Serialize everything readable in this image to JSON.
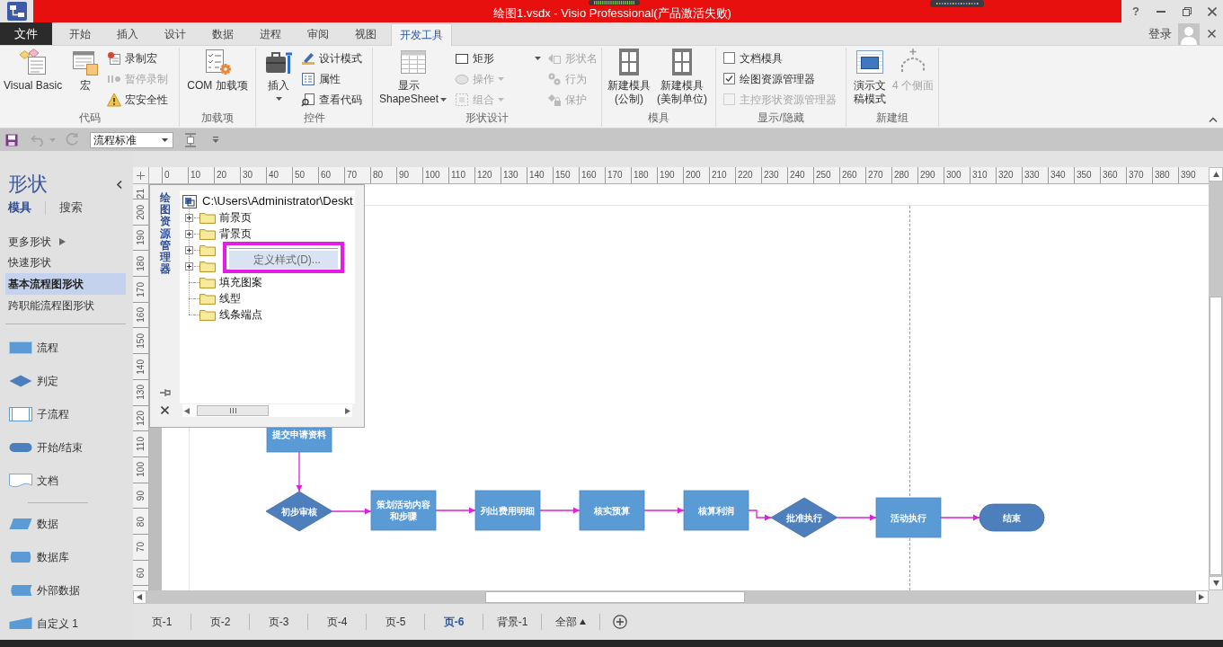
{
  "title_bar": {
    "title": "绘图1.vsdx - Visio Professional(产品激活失败)",
    "help": "?"
  },
  "menu_bar": {
    "file_tab": "文件",
    "tabs": [
      {
        "label": "开始",
        "selected": false
      },
      {
        "label": "插入",
        "selected": false
      },
      {
        "label": "设计",
        "selected": false
      },
      {
        "label": "数据",
        "selected": false
      },
      {
        "label": "进程",
        "selected": false
      },
      {
        "label": "审阅",
        "selected": false
      },
      {
        "label": "视图",
        "selected": false
      },
      {
        "label": "开发工具",
        "selected": true
      }
    ],
    "sign_in": "登录"
  },
  "ribbon": {
    "groups": [
      {
        "label": "代码",
        "columns": [
          [
            {
              "kind": "large",
              "label": "Visual Basic",
              "disabled": false
            }
          ],
          [
            {
              "kind": "large",
              "label": "宏",
              "disabled": false
            }
          ],
          [
            {
              "kind": "small",
              "label": "录制宏",
              "disabled": false
            },
            {
              "kind": "small",
              "label": "暂停录制",
              "disabled": true
            },
            {
              "kind": "small",
              "label": "宏安全性",
              "disabled": false
            }
          ]
        ]
      },
      {
        "label": "加载项",
        "columns": [
          [
            {
              "kind": "large",
              "label": "COM 加载项",
              "disabled": false
            }
          ]
        ]
      },
      {
        "label": "控件",
        "columns": [
          [
            {
              "kind": "large",
              "label": "插入",
              "disabled": false,
              "dropdown": true
            }
          ],
          [
            {
              "kind": "small",
              "label": "设计模式",
              "disabled": false
            },
            {
              "kind": "small",
              "label": "属性",
              "disabled": false
            },
            {
              "kind": "small",
              "label": "查看代码",
              "disabled": false
            }
          ]
        ]
      },
      {
        "label": "形状设计",
        "columns": [
          [
            {
              "kind": "large",
              "label": "显示\nShapeSheet",
              "disabled": false,
              "dropdown": true
            }
          ],
          [
            {
              "kind": "small",
              "label": "矩形",
              "disabled": false,
              "dropdown": true,
              "split": true
            },
            {
              "kind": "small",
              "label": "操作",
              "disabled": true,
              "dropdown": true
            },
            {
              "kind": "small",
              "label": "组合",
              "disabled": true,
              "dropdown": true
            }
          ],
          [
            {
              "kind": "small",
              "label": "形状名",
              "disabled": true
            },
            {
              "kind": "small",
              "label": "行为",
              "disabled": true
            },
            {
              "kind": "small",
              "label": "保护",
              "disabled": true
            }
          ]
        ]
      },
      {
        "label": "模具",
        "columns": [
          [
            {
              "kind": "large",
              "label": "新建模具\n(公制)",
              "disabled": false
            }
          ],
          [
            {
              "kind": "large",
              "label": "新建模具\n(美制单位)",
              "disabled": false
            }
          ]
        ]
      },
      {
        "label": "显示/隐藏",
        "columns": [
          [
            {
              "kind": "checkbox",
              "label": "文档模具",
              "checked": false,
              "disabled": false
            },
            {
              "kind": "checkbox",
              "label": "绘图资源管理器",
              "checked": true,
              "disabled": false
            },
            {
              "kind": "checkbox",
              "label": "主控形状资源管理器",
              "checked": false,
              "disabled": true
            }
          ]
        ]
      },
      {
        "label": "新建组",
        "columns": [
          [
            {
              "kind": "large",
              "label": "演示文稿模式",
              "disabled": false
            }
          ],
          [
            {
              "kind": "large",
              "label": "4 个侧面",
              "disabled": true
            }
          ]
        ]
      }
    ]
  },
  "quick_access": {
    "undo": {
      "disabled": true
    },
    "redo": {
      "disabled": true
    },
    "style_box": {
      "value": "流程标准"
    }
  },
  "shapes_pane": {
    "title": "形状",
    "tabs": [
      {
        "label": "模具",
        "selected": true
      },
      {
        "label": "搜索",
        "selected": false
      }
    ],
    "more_shapes": "更多形状",
    "stencils": [
      {
        "label": "快速形状",
        "selected": false
      },
      {
        "label": "基本流程图形状",
        "selected": true
      },
      {
        "label": "跨职能流程图形状",
        "selected": false
      }
    ],
    "shape_groups": [
      [
        {
          "label": "流程",
          "kind": "process"
        },
        {
          "label": "判定",
          "kind": "decision"
        },
        {
          "label": "子流程",
          "kind": "subprocess"
        },
        {
          "label": "开始/结束",
          "kind": "terminator"
        },
        {
          "label": "文档",
          "kind": "document"
        }
      ],
      [
        {
          "label": "数据",
          "kind": "data"
        },
        {
          "label": "数据库",
          "kind": "database"
        },
        {
          "label": "外部数据",
          "kind": "external_data"
        },
        {
          "label": "自定义 1",
          "kind": "custom"
        }
      ]
    ]
  },
  "rulers": {
    "horizontal": [
      "0",
      "10",
      "20",
      "30",
      "40",
      "50",
      "60",
      "70",
      "80",
      "90",
      "100",
      "110",
      "120",
      "130",
      "140",
      "150",
      "160",
      "170",
      "180",
      "190",
      "200",
      "210",
      "220",
      "230",
      "240",
      "250",
      "260",
      "270",
      "280",
      "290",
      "300",
      "310",
      "320",
      "330",
      "340",
      "350",
      "360",
      "370",
      "380",
      "390"
    ],
    "vertical": [
      "21",
      "200",
      "190",
      "180",
      "170",
      "160",
      "150",
      "140",
      "130",
      "120",
      "110",
      "100",
      "90",
      "80",
      "70",
      "60"
    ]
  },
  "drawing_explorer": {
    "title": "绘图资源管理器",
    "root": "C:\\Users\\Administrator\\Deskt",
    "items": [
      {
        "label": "前景页",
        "expandable": true
      },
      {
        "label": "背景页",
        "expandable": true
      },
      {
        "expandable": true
      },
      {
        "expandable": true
      },
      {
        "label": "填充图案",
        "expandable": false
      },
      {
        "label": "线型",
        "expandable": false
      },
      {
        "label": "线条端点",
        "expandable": false
      }
    ],
    "context_menu": {
      "items": [
        {
          "label": "定义样式(D)...",
          "selected": true
        }
      ]
    }
  },
  "flowchart": {
    "nodes": [
      {
        "kind": "process",
        "label": "提交申请资料"
      },
      {
        "kind": "decision",
        "label": "初步审核"
      },
      {
        "kind": "process",
        "label": "策划活动内容和步骤"
      },
      {
        "kind": "process",
        "label": "列出费用明细"
      },
      {
        "kind": "process",
        "label": "核实预算"
      },
      {
        "kind": "process",
        "label": "核算利润"
      },
      {
        "kind": "decision",
        "label": "批准执行"
      },
      {
        "kind": "process",
        "label": "活动执行"
      },
      {
        "kind": "terminator",
        "label": "结束"
      }
    ]
  },
  "page_tabs": {
    "tabs": [
      {
        "label": "页-1",
        "selected": false
      },
      {
        "label": "页-2",
        "selected": false
      },
      {
        "label": "页-3",
        "selected": false
      },
      {
        "label": "页-4",
        "selected": false
      },
      {
        "label": "页-5",
        "selected": false
      },
      {
        "label": "页-6",
        "selected": true
      },
      {
        "label": "背景-1",
        "selected": false
      }
    ],
    "all_pages": "全部"
  }
}
